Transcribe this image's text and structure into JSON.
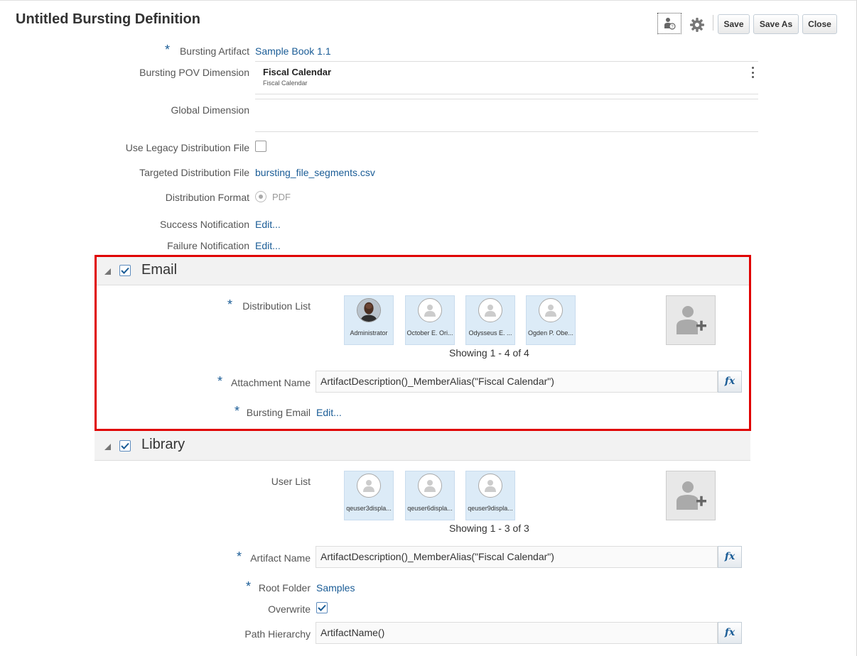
{
  "page": {
    "title": "Untitled Bursting Definition"
  },
  "toolbar": {
    "user_help_icon": "user-question-icon",
    "settings_icon": "gear-icon",
    "save_label": "Save",
    "save_as_label": "Save As",
    "close_label": "Close"
  },
  "form": {
    "bursting_artifact_label": "Bursting Artifact",
    "bursting_artifact_value": "Sample Book 1.1",
    "pov_dimension_label": "Bursting POV Dimension",
    "pov_dimension_name": "Fiscal Calendar",
    "pov_dimension_sub": "Fiscal Calendar",
    "global_dimension_label": "Global Dimension",
    "use_legacy_label": "Use Legacy Distribution File",
    "use_legacy_checked": false,
    "targeted_file_label": "Targeted Distribution File",
    "targeted_file_value": "bursting_file_segments.csv",
    "distribution_format_label": "Distribution Format",
    "distribution_format_value": "PDF",
    "success_notification_label": "Success Notification",
    "success_notification_link": "Edit...",
    "failure_notification_label": "Failure Notification",
    "failure_notification_link": "Edit..."
  },
  "email": {
    "title": "Email",
    "checked": true,
    "distribution_list_label": "Distribution List",
    "users": [
      {
        "name": "Administrator",
        "photo": true
      },
      {
        "name": "October E. Ori...",
        "photo": false
      },
      {
        "name": "Odysseus E. ...",
        "photo": false
      },
      {
        "name": "Ogden P. Obe...",
        "photo": false
      }
    ],
    "showing": "Showing 1 - 4 of 4",
    "attachment_name_label": "Attachment Name",
    "attachment_name_value": "ArtifactDescription()_MemberAlias(\"Fiscal Calendar\")",
    "bursting_email_label": "Bursting Email",
    "bursting_email_link": "Edit..."
  },
  "library": {
    "title": "Library",
    "checked": true,
    "user_list_label": "User List",
    "users": [
      {
        "name": "qeuser3displa..."
      },
      {
        "name": "qeuser6displa..."
      },
      {
        "name": "qeuser9displa..."
      }
    ],
    "showing": "Showing 1 - 3 of 3",
    "artifact_name_label": "Artifact Name",
    "artifact_name_value": "ArtifactDescription()_MemberAlias(\"Fiscal Calendar\")",
    "root_folder_label": "Root Folder",
    "root_folder_value": "Samples",
    "overwrite_label": "Overwrite",
    "overwrite_checked": true,
    "path_hierarchy_label": "Path Hierarchy",
    "path_hierarchy_value": "ArtifactName()"
  },
  "fx_label": "fx",
  "required_mark": "*",
  "colors": {
    "link": "#1a5c96",
    "highlight_border": "#e00000",
    "user_card_bg": "#dcebf7"
  }
}
